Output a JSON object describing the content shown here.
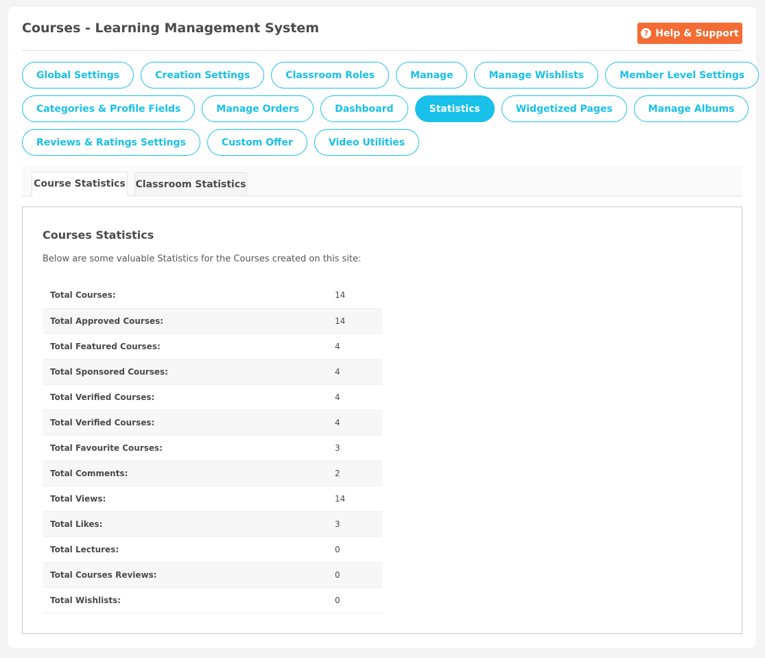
{
  "header": {
    "title": "Courses - Learning Management System",
    "help_button": {
      "icon": "question-circle-icon",
      "label": "Help & Support"
    }
  },
  "nav": {
    "rows": [
      [
        "Global Settings",
        "Creation Settings",
        "Classroom Roles",
        "Manage",
        "Manage Wishlists",
        "Member Level Settings"
      ],
      [
        "Categories & Profile Fields",
        "Manage Orders",
        "Dashboard",
        "Statistics",
        "Widgetized Pages",
        "Manage Albums"
      ],
      [
        "Reviews & Ratings Settings",
        "Custom Offer",
        "Video Utilities"
      ]
    ],
    "active": "Statistics",
    "accent_color": "#19c0ea"
  },
  "tabs": {
    "items": [
      "Course Statistics",
      "Classroom Statistics"
    ],
    "active": "Course Statistics"
  },
  "panel": {
    "title": "Courses Statistics",
    "description": "Below are some valuable Statistics for the Courses created on this site:",
    "stats": [
      {
        "label": "Total Courses:",
        "value": "14"
      },
      {
        "label": "Total Approved Courses:",
        "value": "14"
      },
      {
        "label": "Total Featured Courses:",
        "value": "4"
      },
      {
        "label": "Total Sponsored Courses:",
        "value": "4"
      },
      {
        "label": "Total Verified Courses:",
        "value": "4"
      },
      {
        "label": "Total Verified Courses:",
        "value": "4"
      },
      {
        "label": "Total Favourite Courses:",
        "value": "3"
      },
      {
        "label": "Total Comments:",
        "value": "2"
      },
      {
        "label": "Total Views:",
        "value": "14"
      },
      {
        "label": "Total Likes:",
        "value": "3"
      },
      {
        "label": "Total Lectures:",
        "value": "0"
      },
      {
        "label": "Total Courses Reviews:",
        "value": "0"
      },
      {
        "label": "Total Wishlists:",
        "value": "0"
      }
    ]
  }
}
